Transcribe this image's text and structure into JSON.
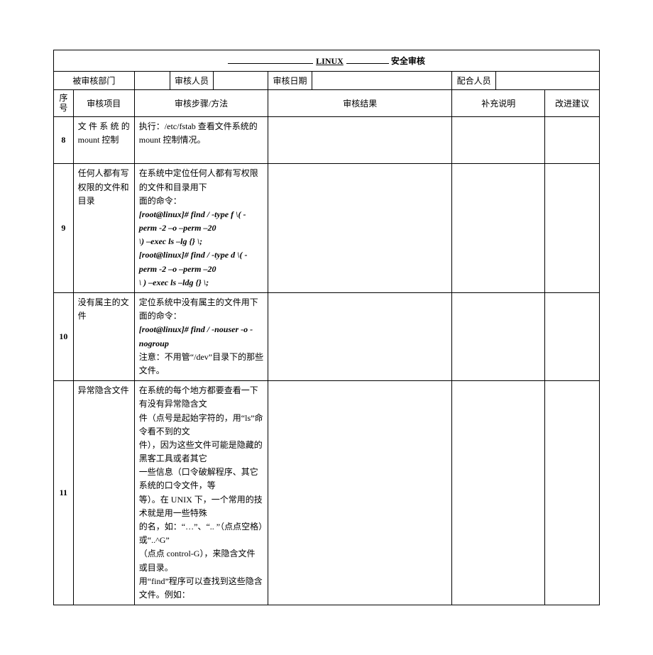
{
  "title": {
    "mid": "LINUX",
    "suffix": "安全审核"
  },
  "header": {
    "dept_label": "被审核部门",
    "auditor_label": "审核人员",
    "date_label": "审核日期",
    "coop_label": "配合人员"
  },
  "columns": {
    "seq": "序号",
    "item": "审核项目",
    "method": "审核步骤/方法",
    "result": "审核结果",
    "supp": "补充说明",
    "improve": "改进建议"
  },
  "rows": {
    "r8": {
      "seq": "8",
      "item_l1": "文件系统的",
      "item_l2": "mount 控制",
      "method_l1": "执行：/etc/fstab 查看文件系统的 mount 控制情况。"
    },
    "r9": {
      "seq": "9",
      "item_l1": "任何人都有写",
      "item_l2": "权限的文件和",
      "item_l3": "目录",
      "method_l1": "在系统中定位任何人都有写权限的文件和目录用下",
      "method_l2": "面的命令：",
      "cmd1a": "[root@linux]# find / -type f   \\( -perm -2 –o –perm –20",
      "cmd1b": "\\) –exec ls –lg {} \\;",
      "cmd2a": "[root@linux]# find / -type d \\( -perm -2 –o –perm –20",
      "cmd2b": "\\ ) –exec ls –ldg {} \\;"
    },
    "r10": {
      "seq": "10",
      "item_l1": "没有属主的文",
      "item_l2": "件",
      "method_l1": "定位系统中没有属主的文件用下面的命令：",
      "cmd": "[root@linux]# find / -nouser -o -nogroup",
      "method_l2": "注意：不用管“/dev”目录下的那些文件。"
    },
    "r11": {
      "seq": "11",
      "item": "异常隐含文件",
      "method_l1": "在系统的每个地方都要查看一下有没有异常隐含文",
      "method_l2": "件（点号是起始字符的，用“ls”命令看不到的文",
      "method_l3": "件），因为这些文件可能是隐藏的黑客工具或者其它",
      "method_l4": "一些信息（口令破解程序、其它系统的口令文件，等",
      "method_l5": "等）。在 UNIX 下，一个常用的技术就是用一些特殊",
      "method_l6": "的名，如：“…”、“..    ”（点点空格）或“..^G”",
      "method_l7": "（点点 control-G），来隐含文件或目录。",
      "method_l8": "用“find”程序可以查找到这些隐含文件。例如："
    }
  }
}
